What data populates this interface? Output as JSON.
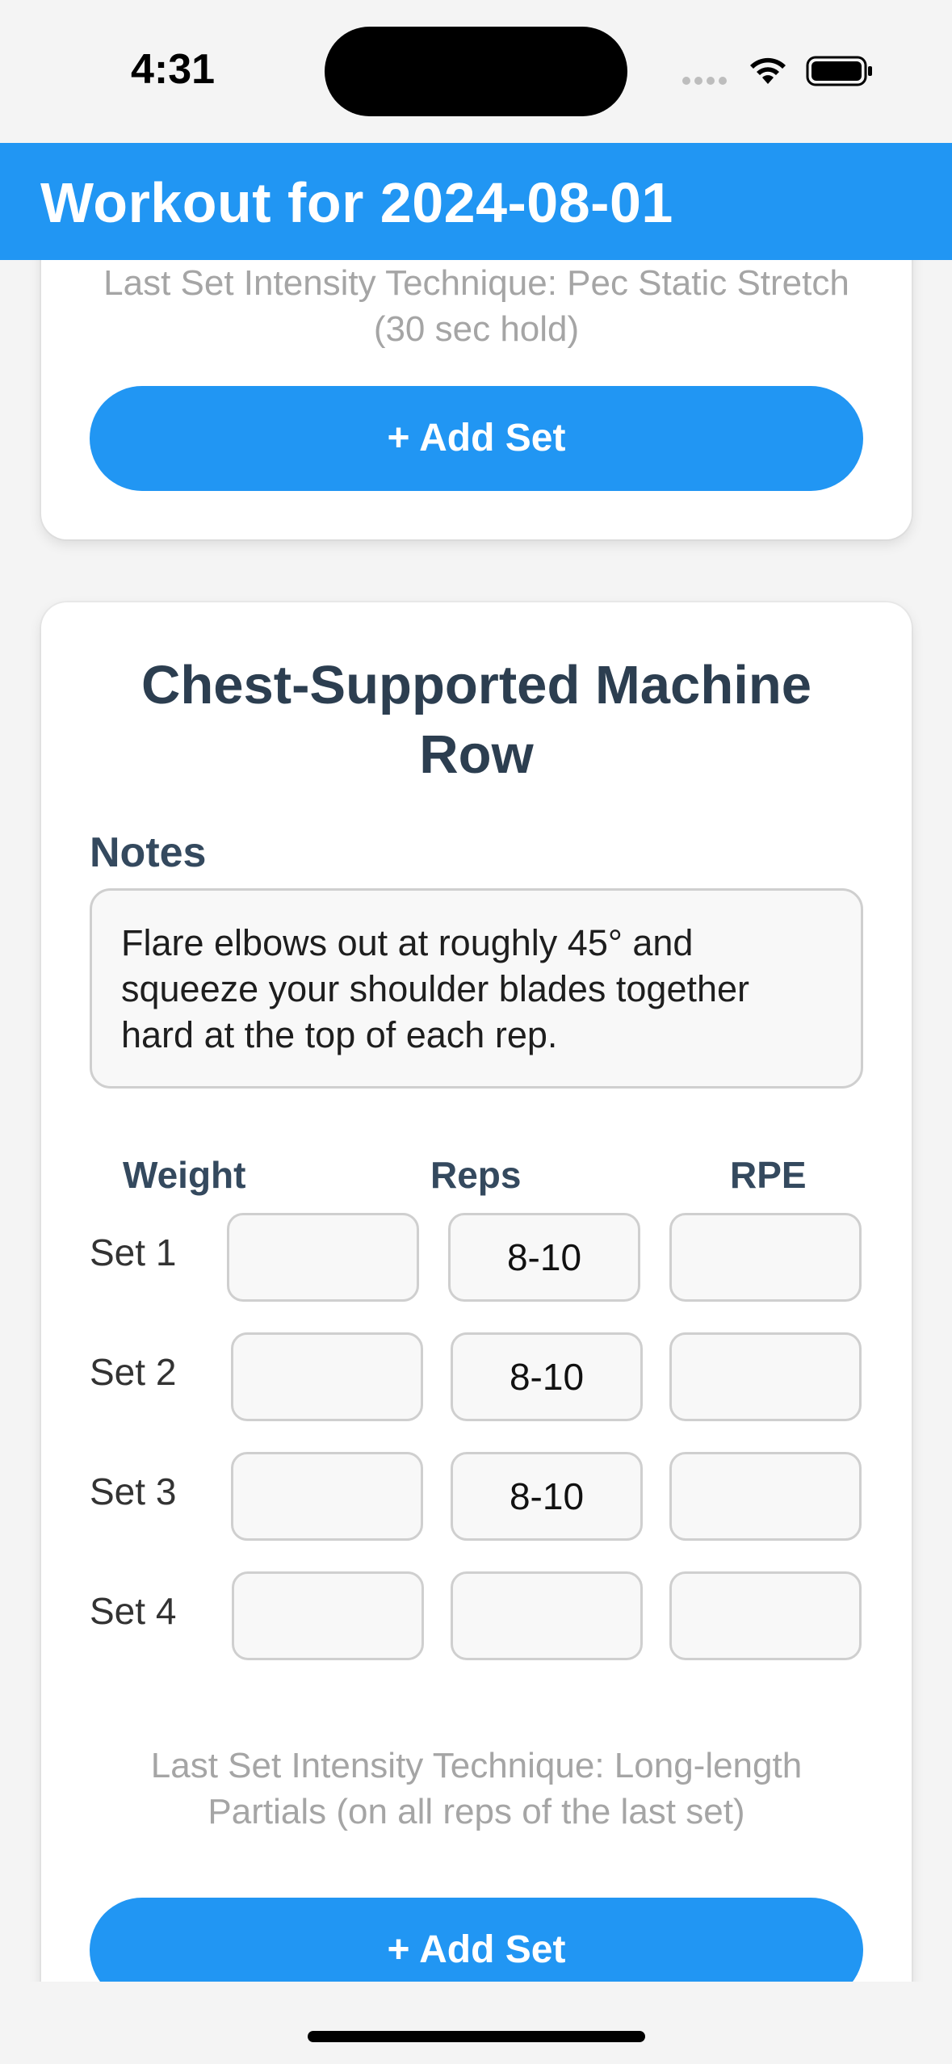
{
  "status": {
    "time": "4:31"
  },
  "header": {
    "title": "Workout for 2024-08-01"
  },
  "previous_exercise": {
    "intensity_text": "Last Set Intensity Technique: Pec Static Stretch (30 sec hold)",
    "add_set_label": "+ Add Set"
  },
  "exercise": {
    "title": "Chest-Supported Machine Row",
    "notes_label": "Notes",
    "notes_text": "Flare elbows out at roughly 45° and squeeze your shoulder blades together hard at the top of each rep.",
    "columns": {
      "weight": "Weight",
      "reps": "Reps",
      "rpe": "RPE"
    },
    "sets": [
      {
        "label": "Set 1",
        "weight": "",
        "reps": "8-10",
        "rpe": ""
      },
      {
        "label": "Set 2",
        "weight": "",
        "reps": "8-10",
        "rpe": ""
      },
      {
        "label": "Set 3",
        "weight": "",
        "reps": "8-10",
        "rpe": ""
      },
      {
        "label": "Set 4",
        "weight": "",
        "reps": "",
        "rpe": ""
      }
    ],
    "intensity_text": "Last Set Intensity Technique: Long-length Partials (on all reps of the last set)",
    "add_set_label": "+ Add Set"
  }
}
